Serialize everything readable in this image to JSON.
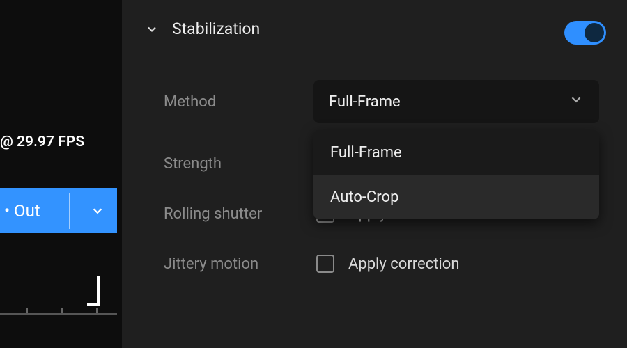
{
  "left": {
    "fps_readout": "@ 29.97 FPS",
    "out_label": "• Out"
  },
  "section": {
    "title": "Stabilization",
    "toggle_on": true
  },
  "method": {
    "label": "Method",
    "selected": "Full-Frame",
    "options": [
      "Full-Frame",
      "Auto-Crop"
    ]
  },
  "strength": {
    "label": "Strength"
  },
  "rolling_shutter": {
    "label": "Rolling shutter",
    "checkbox_label": "Apply correction",
    "checked": false
  },
  "jittery_motion": {
    "label": "Jittery motion",
    "checkbox_label": "Apply correction",
    "checked": false
  },
  "colors": {
    "accent": "#3393ff"
  }
}
